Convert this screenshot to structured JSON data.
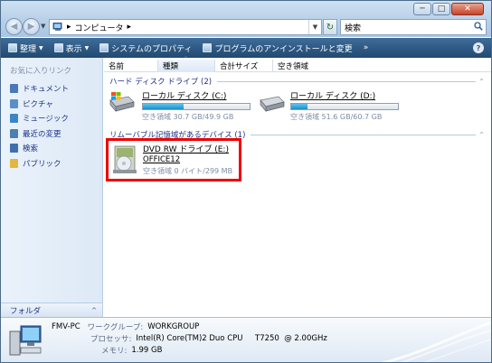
{
  "window": {
    "buttons": {
      "minimize": "─",
      "maximize": "□",
      "close": "✕"
    }
  },
  "nav": {
    "back": "◀",
    "forward": "▶",
    "dropdown": "▼",
    "address_path": "コンピュータ",
    "address_sep_before": "▸",
    "address_sep_after": "▸",
    "address_dropdown": "▼",
    "refresh": "↻",
    "search_placeholder": "検索",
    "search_icon": "search-icon"
  },
  "toolbar": {
    "items": [
      {
        "label": "整理",
        "icon": "organize-icon",
        "arrow": "▼"
      },
      {
        "label": "表示",
        "icon": "views-icon",
        "arrow": "▼"
      },
      {
        "label": "システムのプロパティ",
        "icon": "system-properties-icon"
      },
      {
        "label": "プログラムのアンインストールと変更",
        "icon": "uninstall-icon"
      },
      {
        "label": "»"
      }
    ],
    "help": "?"
  },
  "sidebar": {
    "title": "お気に入りリンク",
    "items": [
      {
        "label": "ドキュメント",
        "icon": "documents-icon",
        "color": "#4a78b8"
      },
      {
        "label": "ピクチャ",
        "icon": "pictures-icon",
        "color": "#5b8fc8"
      },
      {
        "label": "ミュージック",
        "icon": "music-icon",
        "color": "#3d86c6"
      },
      {
        "label": "最近の変更",
        "icon": "recent-icon",
        "color": "#4d7fb0"
      },
      {
        "label": "検索",
        "icon": "search-folder-icon",
        "color": "#3f6fae"
      },
      {
        "label": "パブリック",
        "icon": "public-icon",
        "color": "#e3b640"
      }
    ],
    "folders_label": "フォルダ",
    "folders_arrow": "^"
  },
  "columns": {
    "name": "名前",
    "type": "種類",
    "total": "合計サイズ",
    "free": "空き領域",
    "sort_arrow": "^"
  },
  "groups": {
    "hdd": {
      "title": "ハード ディスク ドライブ (2)",
      "caret": "^"
    },
    "removable": {
      "title": "リムーバブル記憶域があるデバイス (1)",
      "caret": "^"
    }
  },
  "drives": {
    "c": {
      "name": "ローカル ディスク (C:)",
      "free_text": "空き領域 30.7 GB/49.9 GB",
      "used_fraction": 0.38
    },
    "d": {
      "name": "ローカル ディスク (D:)",
      "free_text": "空き領域 51.6 GB/60.7 GB",
      "used_fraction": 0.15
    },
    "e": {
      "name": "DVD RW ドライブ (E:)",
      "label": "OFFICE12",
      "free_text": "空き領域 0 バイト/299 MB"
    }
  },
  "details": {
    "pc_name": "FMV-PC",
    "workgroup_key": "ワークグループ:",
    "workgroup_value": "WORKGROUP",
    "processor_key": "プロセッサ:",
    "processor_value": "Intel(R) Core(TM)2 Duo CPU     T7250  @ 2.00GHz",
    "memory_key": "メモリ:",
    "memory_value": "1.99 GB"
  },
  "colors": {
    "toolbar": "#2f5a85",
    "drive_fill": "#1d8fc9",
    "highlight_box": "#e00000",
    "link_text": "#1e3287"
  }
}
